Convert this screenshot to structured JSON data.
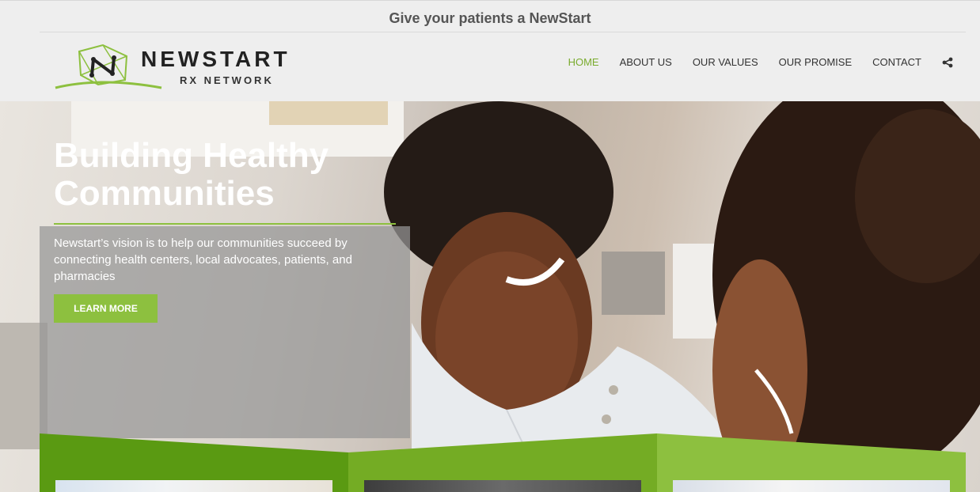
{
  "tagline": "Give your patients a NewStart",
  "logo": {
    "name": "NEWSTART",
    "sub": "RX NETWORK"
  },
  "nav": {
    "items": [
      {
        "label": "HOME",
        "active": true
      },
      {
        "label": "ABOUT US"
      },
      {
        "label": "OUR VALUES"
      },
      {
        "label": "OUR PROMISE"
      },
      {
        "label": "CONTACT"
      }
    ],
    "share_icon": "share-icon"
  },
  "hero": {
    "title": "Building Healthy Communities",
    "text": "Newstart’s vision is to help our communities succeed by connecting health centers, local advocates, patients, and pharmacies",
    "button": "LEARN MORE"
  },
  "colors": {
    "accent": "#8dc03f",
    "nav_active": "#7aab2e",
    "band_dark": "#5a9a12",
    "band_mid": "#74ac24",
    "band_light": "#8dc03f"
  }
}
